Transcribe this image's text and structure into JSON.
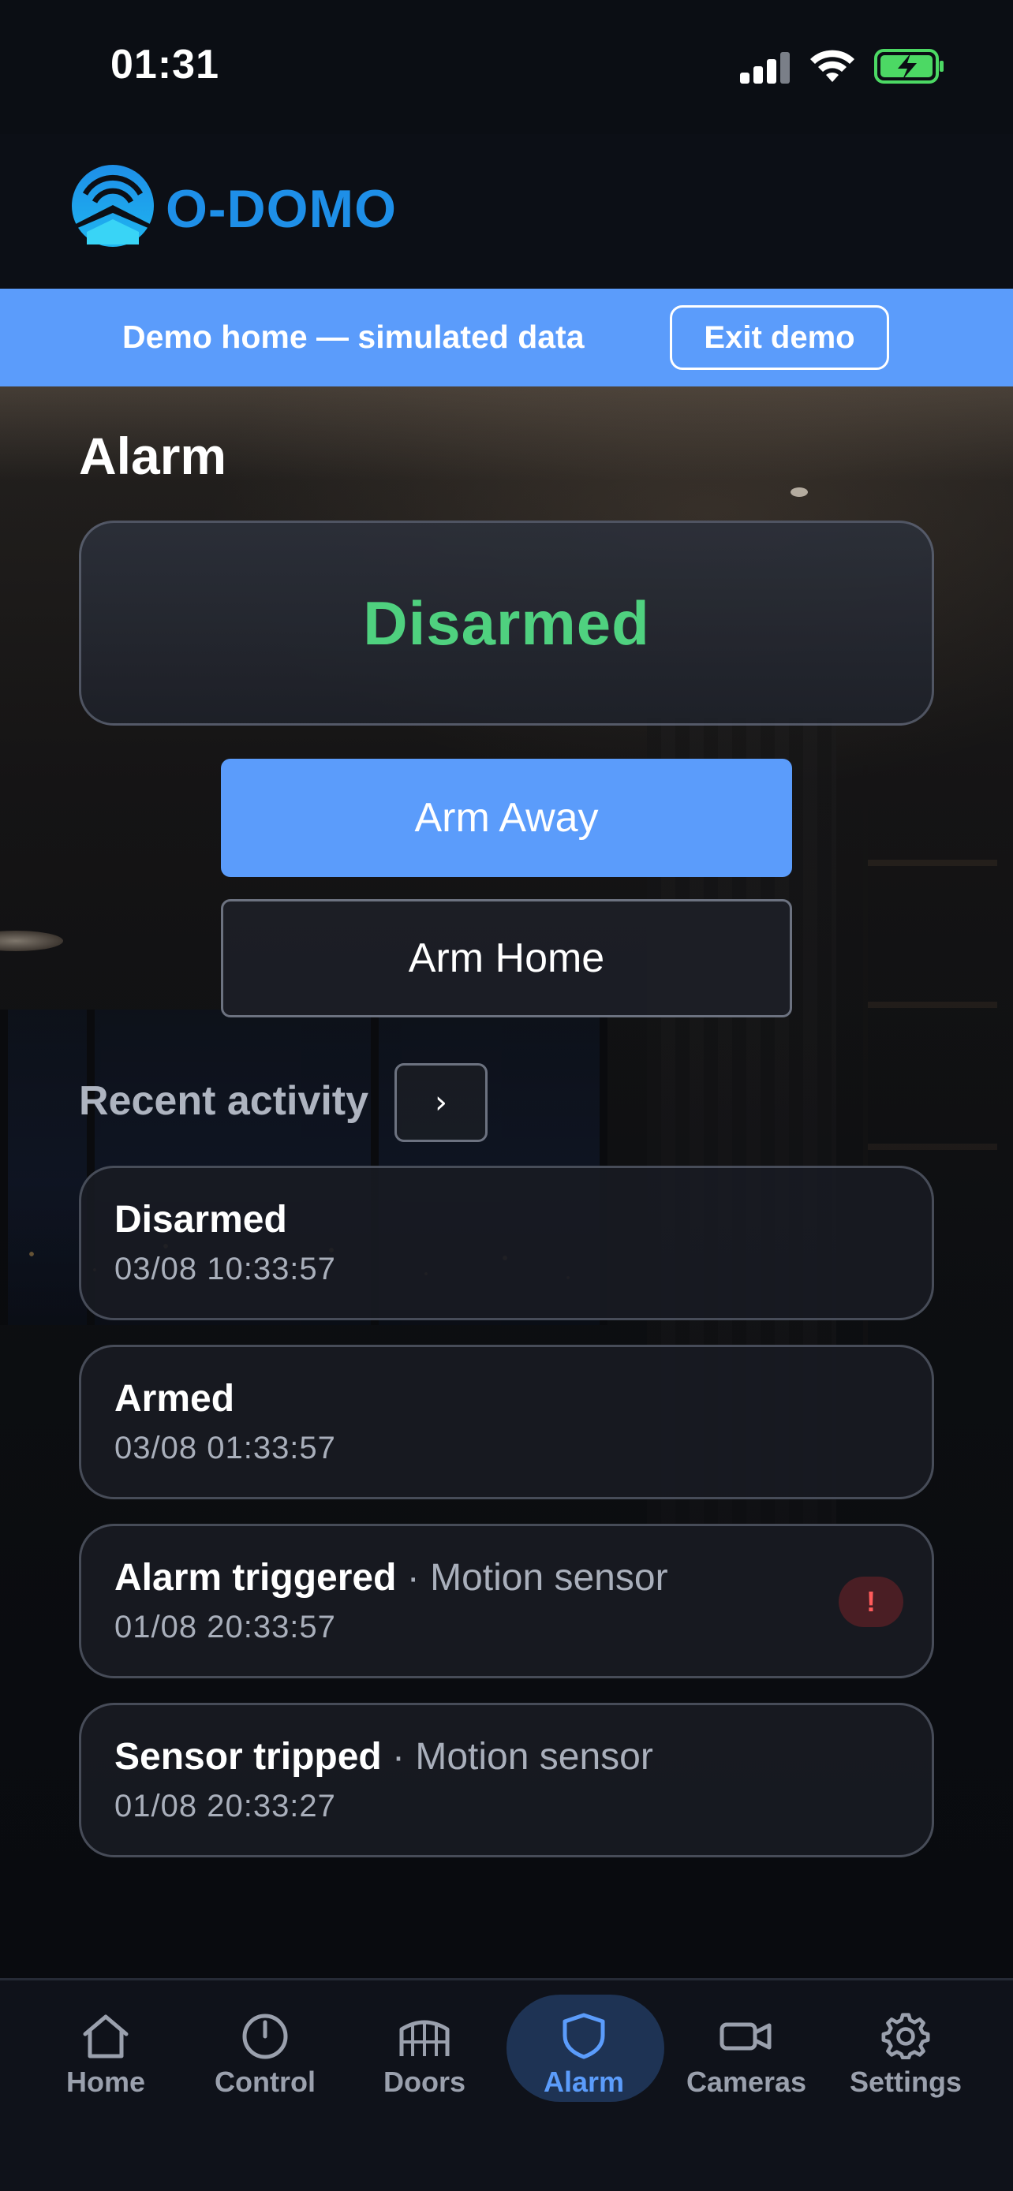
{
  "status_bar": {
    "time": "01:31"
  },
  "header": {
    "logo_text": "O-DOMO"
  },
  "demo_banner": {
    "text": "Demo home — simulated data",
    "exit_label": "Exit demo"
  },
  "alarm": {
    "title": "Alarm",
    "status": "Disarmed",
    "status_color": "#4fd17f",
    "arm_away_label": "Arm Away",
    "arm_home_label": "Arm Home"
  },
  "activity": {
    "title": "Recent activity",
    "more_label": "›",
    "items": [
      {
        "event": "Disarmed",
        "source": "",
        "time": "03/08 10:33:57",
        "alert": false
      },
      {
        "event": "Armed",
        "source": "",
        "time": "03/08 01:33:57",
        "alert": false
      },
      {
        "event": "Alarm triggered",
        "sep": " · ",
        "source": "Motion sensor",
        "time": "01/08 20:33:57",
        "alert": true,
        "alert_symbol": "!"
      },
      {
        "event": "Sensor tripped",
        "sep": " · ",
        "source": "Motion sensor",
        "time": "01/08 20:33:27",
        "alert": false
      }
    ]
  },
  "tab_bar": {
    "active": "Alarm",
    "accent_color": "#5b9cfb",
    "tabs": [
      {
        "label": "Home",
        "icon": "home-icon"
      },
      {
        "label": "Control",
        "icon": "power-icon"
      },
      {
        "label": "Doors",
        "icon": "gate-icon"
      },
      {
        "label": "Alarm",
        "icon": "shield-icon"
      },
      {
        "label": "Cameras",
        "icon": "video-camera-icon"
      },
      {
        "label": "Settings",
        "icon": "gear-icon"
      }
    ]
  }
}
